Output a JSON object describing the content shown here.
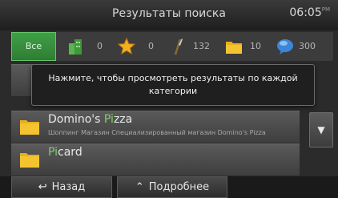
{
  "header": {
    "title": "Результаты поиска",
    "clock": "06:05",
    "clock_suffix": "PM"
  },
  "filters": {
    "all_label": "Все",
    "categories": [
      {
        "icon": "green-building-icon",
        "count": "0"
      },
      {
        "icon": "star-icon",
        "count": "0"
      },
      {
        "icon": "fork-knife-icon",
        "count": "132"
      },
      {
        "icon": "yellow-folder-icon",
        "count": "10"
      },
      {
        "icon": "chat-bubble-icon",
        "count": "300"
      }
    ]
  },
  "tooltip": {
    "text": "Нажмите, чтобы просмотреть результаты по каждой категории"
  },
  "results": [
    {
      "name_prefix": "Domino's ",
      "name_highlight": "Pi",
      "name_suffix": "zza",
      "subtitle": "Шоппинг Магазин Специализированный магазин Domino's Pizza"
    },
    {
      "name_prefix": "",
      "name_highlight": "Pi",
      "name_suffix": "card",
      "subtitle": ""
    }
  ],
  "scroll": {
    "down_glyph": "▼"
  },
  "buttons": {
    "back_glyph": "↩",
    "back_label": "Назад",
    "more_glyph": "⌃",
    "more_label": "Подробнее"
  },
  "colors": {
    "accent_green": "#3fa046",
    "highlight_green": "#7fd16b"
  }
}
